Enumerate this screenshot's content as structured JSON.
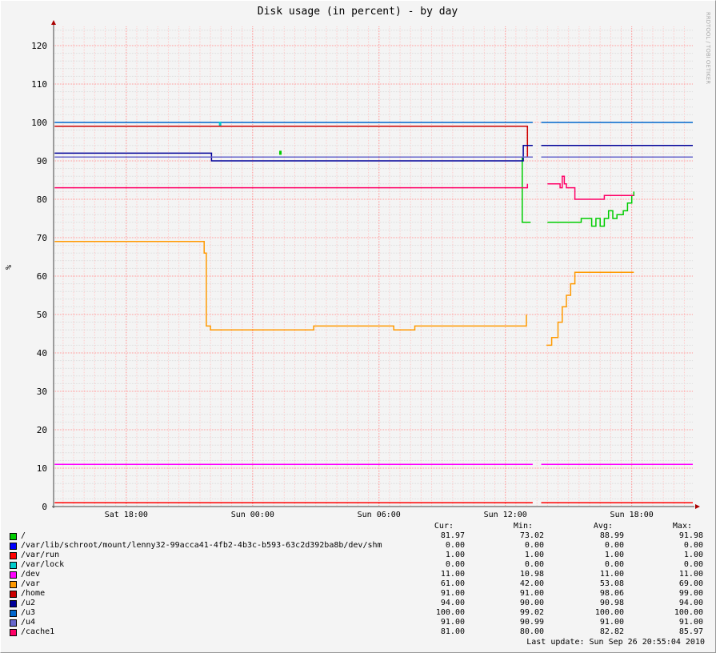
{
  "chart_data": {
    "type": "line",
    "title": "Disk usage (in percent) - by day",
    "ylabel": "%",
    "watermark": "RRDTOOL / TOBI OETIKER",
    "ylim": [
      0,
      125
    ],
    "y_ticks": [
      0,
      10,
      20,
      30,
      40,
      50,
      60,
      70,
      80,
      90,
      100,
      110,
      120
    ],
    "x_ticks": [
      {
        "label": "Sat 18:00",
        "hour": 18
      },
      {
        "label": "Sun 00:00",
        "hour": 24
      },
      {
        "label": "Sun 06:00",
        "hour": 30
      },
      {
        "label": "Sun 12:00",
        "hour": 36
      },
      {
        "label": "Sun 18:00",
        "hour": 42
      }
    ],
    "xlim": [
      14.55,
      44.9
    ],
    "grid": true,
    "series": [
      {
        "name": "/",
        "color": "#00cc00",
        "points": [
          [
            36.8,
            null
          ],
          [
            36.75,
            91
          ],
          [
            36.8,
            74
          ],
          [
            37.2,
            74
          ],
          [
            37.35,
            null
          ],
          [
            38.0,
            74
          ],
          [
            39.5,
            74
          ],
          [
            39.6,
            75
          ],
          [
            40.0,
            75
          ],
          [
            40.1,
            73
          ],
          [
            40.3,
            75
          ],
          [
            40.5,
            73
          ],
          [
            40.7,
            75
          ],
          [
            40.9,
            77
          ],
          [
            41.1,
            75
          ],
          [
            41.3,
            76
          ],
          [
            41.6,
            77
          ],
          [
            41.8,
            79
          ],
          [
            42.0,
            81
          ],
          [
            42.1,
            82
          ]
        ],
        "flecks": [
          [
            25.3,
            92
          ]
        ]
      },
      {
        "name": "/var/lib/schroot/mount/lenny32-99acca41-4fb2-4b3c-b593-63c2d392ba8b/dev/shm",
        "color": "#0000ff",
        "points": []
      },
      {
        "name": "/var/run",
        "color": "#ff0000",
        "points": [
          [
            14.6,
            1
          ],
          [
            37.3,
            1
          ],
          [
            null,
            null
          ],
          [
            37.7,
            1
          ],
          [
            44.9,
            1
          ]
        ]
      },
      {
        "name": "/var/lock",
        "color": "#00cccc",
        "points": []
      },
      {
        "name": "/dev",
        "color": "#ff00ff",
        "points": [
          [
            14.6,
            11
          ],
          [
            37.3,
            11
          ],
          [
            null,
            null
          ],
          [
            37.7,
            11
          ],
          [
            44.9,
            11
          ]
        ]
      },
      {
        "name": "/var",
        "color": "#ff9900",
        "points": [
          [
            14.6,
            69
          ],
          [
            21.5,
            69
          ],
          [
            21.7,
            66
          ],
          [
            21.8,
            47
          ],
          [
            22.0,
            46
          ],
          [
            26.8,
            46
          ],
          [
            26.9,
            47
          ],
          [
            30.6,
            47
          ],
          [
            30.7,
            46
          ],
          [
            31.6,
            46
          ],
          [
            31.7,
            47
          ],
          [
            36.85,
            47
          ],
          [
            37.0,
            50
          ],
          [
            37.3,
            null
          ],
          [
            37.95,
            42
          ],
          [
            38.2,
            44
          ],
          [
            38.5,
            48
          ],
          [
            38.7,
            52
          ],
          [
            38.9,
            55
          ],
          [
            39.1,
            58
          ],
          [
            39.3,
            61
          ],
          [
            42.1,
            61
          ]
        ]
      },
      {
        "name": "/home",
        "color": "#cc0000",
        "points": [
          [
            14.6,
            99
          ],
          [
            37.0,
            99
          ],
          [
            37.05,
            91
          ],
          [
            37.3,
            91
          ]
        ]
      },
      {
        "name": "/u2",
        "color": "#000099",
        "points": [
          [
            14.6,
            92
          ],
          [
            22.0,
            92
          ],
          [
            22.05,
            90
          ],
          [
            36.8,
            90
          ],
          [
            36.85,
            94
          ],
          [
            37.3,
            94
          ],
          [
            null,
            null
          ],
          [
            37.7,
            94
          ],
          [
            44.9,
            94
          ]
        ]
      },
      {
        "name": "/u3",
        "color": "#0066cc",
        "points": [
          [
            14.6,
            100
          ],
          [
            37.3,
            100
          ],
          [
            null,
            null
          ],
          [
            37.7,
            100
          ],
          [
            44.9,
            100
          ]
        ]
      },
      {
        "name": "/u4",
        "color": "#6666cc",
        "points": [
          [
            14.6,
            91
          ],
          [
            37.3,
            91
          ],
          [
            null,
            null
          ],
          [
            37.7,
            91
          ],
          [
            44.9,
            91
          ]
        ]
      },
      {
        "name": "/cache1",
        "color": "#ff0066",
        "points": [
          [
            14.6,
            83
          ],
          [
            36.9,
            83
          ],
          [
            37.05,
            84
          ],
          [
            37.3,
            null
          ],
          [
            38.0,
            84
          ],
          [
            38.5,
            84
          ],
          [
            38.6,
            83
          ],
          [
            38.7,
            86
          ],
          [
            38.8,
            84
          ],
          [
            38.9,
            83
          ],
          [
            39.3,
            80
          ],
          [
            40.6,
            80
          ],
          [
            40.7,
            81
          ],
          [
            42.1,
            81
          ]
        ]
      }
    ]
  },
  "legend": {
    "headers": {
      "cur": "Cur:",
      "min": "Min:",
      "avg": "Avg:",
      "max": "Max:"
    },
    "rows": [
      {
        "name": "/",
        "color": "#00cc00",
        "cur": "81.97",
        "min": "73.02",
        "avg": "88.99",
        "max": "91.98"
      },
      {
        "name": "/var/lib/schroot/mount/lenny32-99acca41-4fb2-4b3c-b593-63c2d392ba8b/dev/shm",
        "color": "#0000ff",
        "cur": "0.00",
        "min": "0.00",
        "avg": "0.00",
        "max": "0.00"
      },
      {
        "name": "/var/run",
        "color": "#ff0000",
        "cur": "1.00",
        "min": "1.00",
        "avg": "1.00",
        "max": "1.00"
      },
      {
        "name": "/var/lock",
        "color": "#00cccc",
        "cur": "0.00",
        "min": "0.00",
        "avg": "0.00",
        "max": "0.00"
      },
      {
        "name": "/dev",
        "color": "#ff00ff",
        "cur": "11.00",
        "min": "10.98",
        "avg": "11.00",
        "max": "11.00"
      },
      {
        "name": "/var",
        "color": "#ff9900",
        "cur": "61.00",
        "min": "42.00",
        "avg": "53.08",
        "max": "69.00"
      },
      {
        "name": "/home",
        "color": "#cc0000",
        "cur": "91.00",
        "min": "91.00",
        "avg": "98.06",
        "max": "99.00"
      },
      {
        "name": "/u2",
        "color": "#000099",
        "cur": "94.00",
        "min": "90.00",
        "avg": "90.98",
        "max": "94.00"
      },
      {
        "name": "/u3",
        "color": "#0066cc",
        "cur": "100.00",
        "min": "99.02",
        "avg": "100.00",
        "max": "100.00"
      },
      {
        "name": "/u4",
        "color": "#6666cc",
        "cur": "91.00",
        "min": "90.99",
        "avg": "91.00",
        "max": "91.00"
      },
      {
        "name": "/cache1",
        "color": "#ff0066",
        "cur": "81.00",
        "min": "80.00",
        "avg": "82.82",
        "max": "85.97"
      }
    ]
  },
  "last_update": "Last update: Sun Sep 26 20:55:04 2010"
}
